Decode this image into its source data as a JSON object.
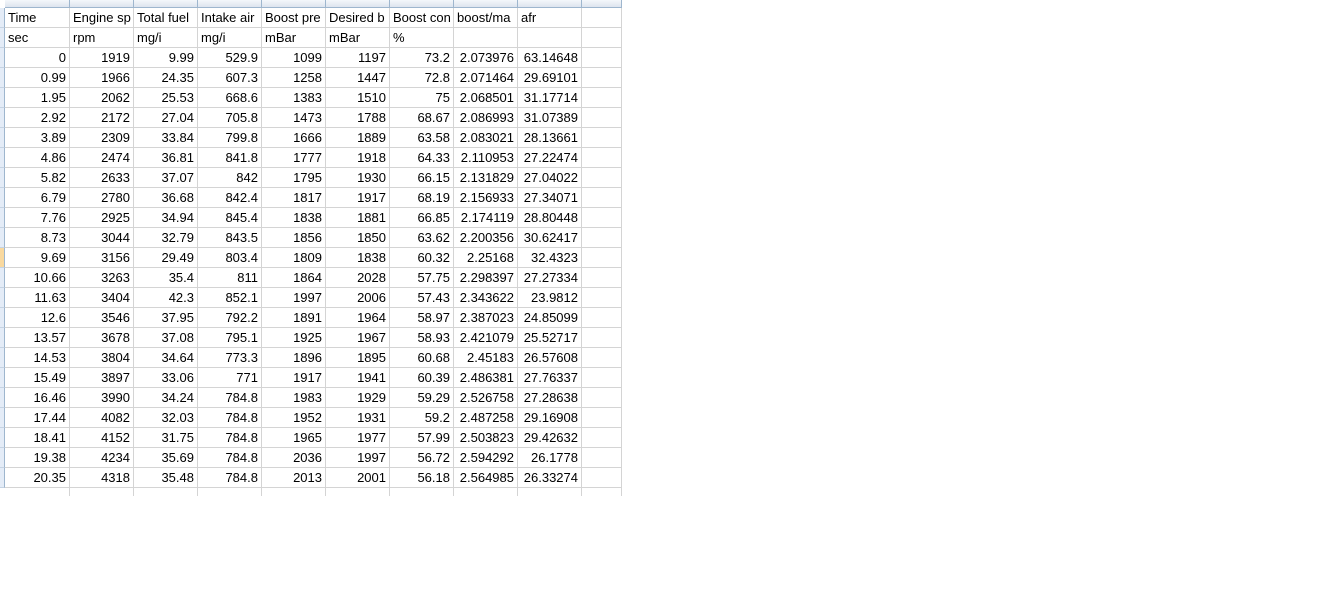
{
  "sheet": {
    "header_row": [
      "Time",
      "Engine speed",
      "Total fuel",
      "Intake air",
      "Boost pressure",
      "Desired boost",
      "Boost con",
      "boost/map",
      "afr"
    ],
    "header_display": [
      "Time",
      "Engine sp",
      "Total fuel",
      "Intake air",
      "Boost pre",
      "Desired b",
      "Boost con",
      "boost/ma",
      "afr"
    ],
    "units_row": [
      "sec",
      "rpm",
      "mg/i",
      "mg/i",
      "mBar",
      "mBar",
      "%",
      "",
      ""
    ],
    "rows": [
      [
        "0",
        "1919",
        "9.99",
        "529.9",
        "1099",
        "1197",
        "73.2",
        "2.073976",
        "63.14648"
      ],
      [
        "0.99",
        "1966",
        "24.35",
        "607.3",
        "1258",
        "1447",
        "72.8",
        "2.071464",
        "29.69101"
      ],
      [
        "1.95",
        "2062",
        "25.53",
        "668.6",
        "1383",
        "1510",
        "75",
        "2.068501",
        "31.17714"
      ],
      [
        "2.92",
        "2172",
        "27.04",
        "705.8",
        "1473",
        "1788",
        "68.67",
        "2.086993",
        "31.07389"
      ],
      [
        "3.89",
        "2309",
        "33.84",
        "799.8",
        "1666",
        "1889",
        "63.58",
        "2.083021",
        "28.13661"
      ],
      [
        "4.86",
        "2474",
        "36.81",
        "841.8",
        "1777",
        "1918",
        "64.33",
        "2.110953",
        "27.22474"
      ],
      [
        "5.82",
        "2633",
        "37.07",
        "842",
        "1795",
        "1930",
        "66.15",
        "2.131829",
        "27.04022"
      ],
      [
        "6.79",
        "2780",
        "36.68",
        "842.4",
        "1817",
        "1917",
        "68.19",
        "2.156933",
        "27.34071"
      ],
      [
        "7.76",
        "2925",
        "34.94",
        "845.4",
        "1838",
        "1881",
        "66.85",
        "2.174119",
        "28.80448"
      ],
      [
        "8.73",
        "3044",
        "32.79",
        "843.5",
        "1856",
        "1850",
        "63.62",
        "2.200356",
        "30.62417"
      ],
      [
        "9.69",
        "3156",
        "29.49",
        "803.4",
        "1809",
        "1838",
        "60.32",
        "2.25168",
        "32.4323"
      ],
      [
        "10.66",
        "3263",
        "35.4",
        "811",
        "1864",
        "2028",
        "57.75",
        "2.298397",
        "27.27334"
      ],
      [
        "11.63",
        "3404",
        "42.3",
        "852.1",
        "1997",
        "2006",
        "57.43",
        "2.343622",
        "23.9812"
      ],
      [
        "12.6",
        "3546",
        "37.95",
        "792.2",
        "1891",
        "1964",
        "58.97",
        "2.387023",
        "24.85099"
      ],
      [
        "13.57",
        "3678",
        "37.08",
        "795.1",
        "1925",
        "1967",
        "58.93",
        "2.421079",
        "25.52717"
      ],
      [
        "14.53",
        "3804",
        "34.64",
        "773.3",
        "1896",
        "1895",
        "60.68",
        "2.45183",
        "26.57608"
      ],
      [
        "15.49",
        "3897",
        "33.06",
        "771",
        "1917",
        "1941",
        "60.39",
        "2.486381",
        "27.76337"
      ],
      [
        "16.46",
        "3990",
        "34.24",
        "784.8",
        "1983",
        "1929",
        "59.29",
        "2.526758",
        "27.28638"
      ],
      [
        "17.44",
        "4082",
        "32.03",
        "784.8",
        "1952",
        "1931",
        "59.2",
        "2.487258",
        "29.16908"
      ],
      [
        "18.41",
        "4152",
        "31.75",
        "784.8",
        "1965",
        "1977",
        "57.99",
        "2.503823",
        "29.42632"
      ],
      [
        "19.38",
        "4234",
        "35.69",
        "784.8",
        "2036",
        "1997",
        "56.72",
        "2.594292",
        "26.1778"
      ],
      [
        "20.35",
        "4318",
        "35.48",
        "784.8",
        "2013",
        "2001",
        "56.18",
        "2.564985",
        "26.33274"
      ]
    ],
    "active_row_index": 10
  }
}
